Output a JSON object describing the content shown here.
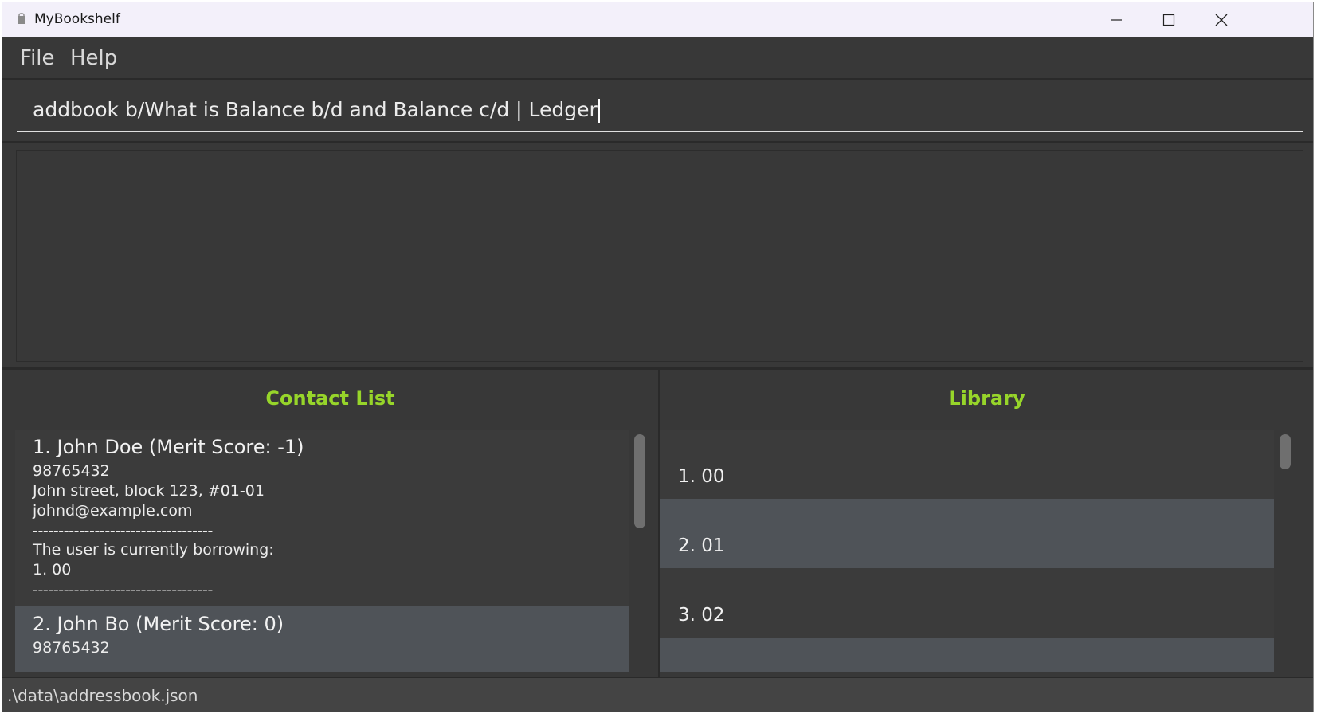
{
  "window": {
    "title": "MyBookshelf",
    "icon": "app-icon",
    "controls": [
      "minimize-icon",
      "maximize-icon",
      "close-icon"
    ]
  },
  "menu": {
    "file": "File",
    "help": "Help"
  },
  "command": {
    "value": "addbook b/What is Balance b/d and Balance c/d | Ledger"
  },
  "result": {
    "text": ""
  },
  "contacts": {
    "title": "Contact List",
    "items": [
      {
        "name": "1.  John Doe (Merit Score: -1)",
        "phone": "98765432",
        "address": "John street, block 123, #01-01",
        "email": "johnd@example.com",
        "divider": "-----------------------------------",
        "borrowing_label": "The user is currently borrowing:",
        "borrowing_item": "1. 00",
        "divider2": "-----------------------------------"
      },
      {
        "name": "2.  John Bo (Merit Score: 0)",
        "phone": "98765432"
      }
    ]
  },
  "library": {
    "title": "Library",
    "items": [
      "1. 00",
      "2. 01",
      "3. 02"
    ]
  },
  "status": {
    "path": ".\\data\\addressbook.json"
  },
  "colors": {
    "accent": "#97d52a",
    "background": "#383838",
    "alt_row": "#4f5358"
  }
}
